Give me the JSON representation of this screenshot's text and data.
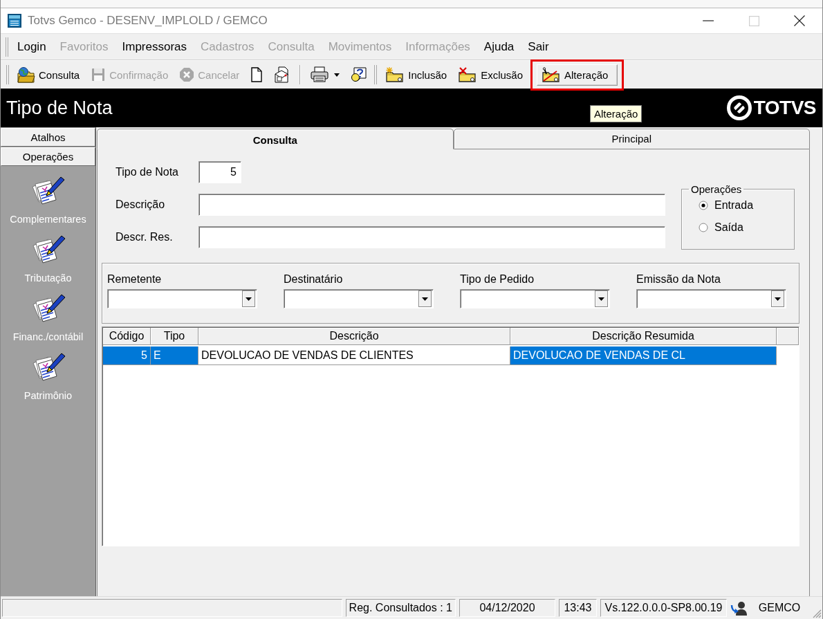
{
  "window": {
    "title": "Totvs Gemco - DESENV_IMPLOLD / GEMCO",
    "controls": [
      {
        "kind": "minimize",
        "disabled": false
      },
      {
        "kind": "maximize",
        "disabled": true
      },
      {
        "kind": "close",
        "disabled": false
      }
    ]
  },
  "menu": [
    {
      "label": "Login",
      "disabled": false
    },
    {
      "label": "Favoritos",
      "disabled": true
    },
    {
      "label": "Impressoras",
      "disabled": false
    },
    {
      "label": "Cadastros",
      "disabled": true
    },
    {
      "label": "Consulta",
      "disabled": true
    },
    {
      "label": "Movimentos",
      "disabled": true
    },
    {
      "label": "Informações",
      "disabled": true
    },
    {
      "label": "Ajuda",
      "disabled": false
    },
    {
      "label": "Sair",
      "disabled": false
    }
  ],
  "toolbar": [
    {
      "kind": "button",
      "label": "Consulta",
      "disabled": false,
      "hovered": false,
      "highlighted": false
    },
    {
      "kind": "button",
      "label": "Confirmação",
      "disabled": true,
      "hovered": false,
      "highlighted": false
    },
    {
      "kind": "button",
      "label": "Cancelar",
      "disabled": true,
      "hovered": false,
      "highlighted": false
    },
    {
      "kind": "icon",
      "disabled": false,
      "hovered": false
    },
    {
      "kind": "icon",
      "disabled": false,
      "hovered": false
    },
    {
      "kind": "separator"
    },
    {
      "kind": "dropdown",
      "disabled": false,
      "hovered": false
    },
    {
      "kind": "icon",
      "disabled": false,
      "hovered": false
    },
    {
      "kind": "grip"
    },
    {
      "kind": "button",
      "label": "Inclusão",
      "disabled": false,
      "hovered": false,
      "highlighted": false
    },
    {
      "kind": "button",
      "label": "Exclusão",
      "disabled": false,
      "hovered": false,
      "highlighted": false
    },
    {
      "kind": "button",
      "label": "Alteração",
      "disabled": false,
      "hovered": true,
      "highlighted": true
    }
  ],
  "header": {
    "title": "Tipo de Nota",
    "logo": "TOTVS"
  },
  "tooltip": {
    "text": "Alteração"
  },
  "sidebar": {
    "sections": [
      "Atalhos",
      "Operações"
    ],
    "items": [
      "Complementares",
      "Tributação",
      "Financ./contábil",
      "Patrimônio"
    ]
  },
  "tabs": [
    {
      "label": "Consulta",
      "selected": true
    },
    {
      "label": "Principal",
      "selected": false
    }
  ],
  "form": {
    "fields": [
      {
        "kind": "number",
        "label": "Tipo de Nota",
        "value": "5"
      },
      {
        "kind": "text",
        "label": "Descrição"
      },
      {
        "kind": "text",
        "label": "Descr. Res."
      }
    ],
    "operations": {
      "title": "Operações",
      "options": [
        {
          "label": "Entrada",
          "selected": true
        },
        {
          "label": "Saída",
          "selected": false
        }
      ]
    }
  },
  "filters": [
    {
      "label": "Remetente"
    },
    {
      "label": "Destinatário"
    },
    {
      "label": "Tipo de Pedido"
    },
    {
      "label": "Emissão da Nota"
    }
  ],
  "grid": {
    "columns": [
      "Código",
      "Tipo",
      "Descrição",
      "Descrição Resumida"
    ],
    "rows": [
      {
        "selected": true,
        "cells": [
          {
            "text": "5",
            "current": false
          },
          {
            "text": "E",
            "current": false
          },
          {
            "text": "DEVOLUCAO DE VENDAS DE CLIENTES",
            "current": true
          },
          {
            "text": "DEVOLUCAO DE VENDAS DE CL",
            "current": false
          }
        ]
      }
    ]
  },
  "status_bar": {
    "panels": [
      {
        "kind": "sunken",
        "text": "Reg. Consultados : 1"
      },
      {
        "kind": "sunken",
        "text": "04/12/2020"
      },
      {
        "kind": "sunken",
        "text": "13:43"
      },
      {
        "kind": "sunken",
        "text": "Vs.122.0.0.0-SP8.00.19"
      },
      {
        "kind": "plain",
        "text": "GEMCO"
      }
    ]
  }
}
